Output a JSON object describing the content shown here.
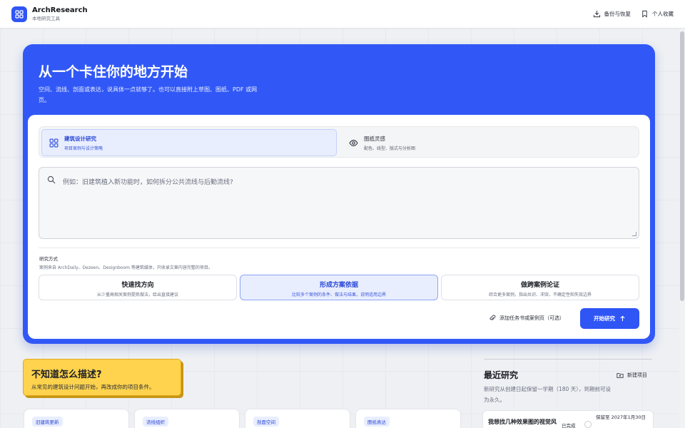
{
  "app": {
    "name": "ArchResearch",
    "subtitle": "本地研究工具",
    "accent_color": "#2f55f5"
  },
  "header": {
    "actions": [
      {
        "label": "备份与恢复",
        "icon": "backup-icon"
      },
      {
        "label": "个人收藏",
        "icon": "bookmark-icon"
      }
    ]
  },
  "hero": {
    "title": "从一个卡住你的地方开始",
    "description": "空间、流线、剖面或表达，说具体一点就够了。也可以直接附上草图、图纸、PDF 或网页。",
    "modes": [
      {
        "title": "建筑设计研究",
        "subtitle": "项目案例与设计策略",
        "icon": "grid-icon",
        "active": true
      },
      {
        "title": "图纸灵感",
        "subtitle": "配色、线型、版式与分析图",
        "icon": "eye-icon",
        "active": false
      }
    ],
    "query_placeholder": "例如：旧建筑植入新功能时，如何拆分公共流线与后勤流线?",
    "method_label": "研究方式",
    "method_note": "案例来自 ArchDaily、Dezeen、Designboom 等建筑媒体，只收录文章内容完整的项目。",
    "methods": [
      {
        "title": "快速找方向",
        "subtitle": "从少量高相关案例提炼做法，给出直接建议",
        "active": false
      },
      {
        "title": "形成方案依据",
        "subtitle": "比较多个案例的条件、做法与结果，说明适用边界",
        "active": true
      },
      {
        "title": "做跨案例论证",
        "subtitle": "综合更多案例，指出共识、冲突、不确定性和失效边界",
        "active": false
      }
    ],
    "attach_label": "添加任务书或案例页（可选）",
    "start_label": "开始研究"
  },
  "tip": {
    "title": "不知道怎么描述?",
    "subtitle": "从常见的建筑设计问题开始，再改成你的项目条件。"
  },
  "topic_cards": [
    "旧建筑更新",
    "流线组织",
    "剖面空间",
    "图纸表达"
  ],
  "recent": {
    "title": "最近研究",
    "new_label": "新建项目",
    "description": "新研究从创建日起保留一学期（180 天），到期前可设为永久。",
    "items": [
      {
        "title": "我想找几种效果图的视觉风格研究",
        "status": "已完成",
        "keep": "保留至 2027年1月30日"
      }
    ]
  }
}
